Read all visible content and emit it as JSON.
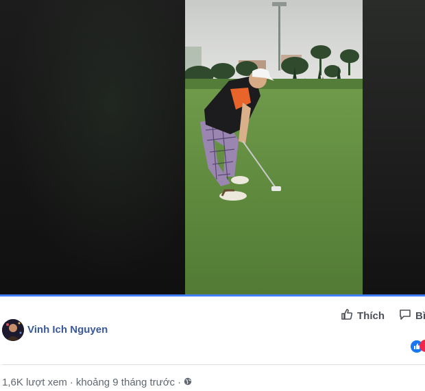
{
  "video": {
    "progress_fraction": 1.0,
    "accent_color": "#4080ff"
  },
  "post": {
    "author_name": "Vinh Ich Nguyen",
    "actions": {
      "like_label": "Thích",
      "share_label": "Bì"
    },
    "views": "1,6K lượt xem",
    "separator": "·",
    "time": "khoảng 9 tháng trước",
    "privacy_icon": "globe-icon",
    "link_color": "#385898"
  }
}
